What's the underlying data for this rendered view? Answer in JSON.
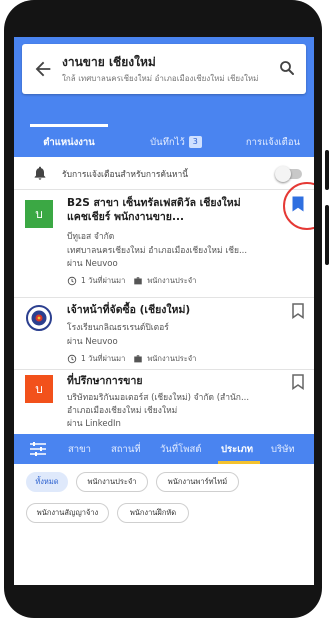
{
  "search": {
    "title": "งานขาย เชียงใหม่",
    "subtitle": "ใกล้ เทศบาลนครเชียงใหม่ อำเภอเมืองเชียงใหม่ เชียงใหม่"
  },
  "tabs": [
    {
      "label": "ตำแหน่งงาน",
      "active": true
    },
    {
      "label": "บันทึกไว้",
      "count": "3",
      "active": false
    },
    {
      "label": "การแจ้งเตือน",
      "active": false
    }
  ],
  "alert": {
    "text": "รับการแจ้งเตือนสำหรับการค้นหานี้",
    "enabled": false
  },
  "jobs": [
    {
      "logo_text": "บ",
      "logo_color": "#3ba844",
      "title_line1": "B2S สาขา เซ็นทรัลเฟสติวัล เชียงใหม่",
      "title_line2": "แคชเชียร์ พนักงานขาย...",
      "company": "บีทูเอส จำกัด",
      "location": "เทศบาลนครเชียงใหม่ อำเภอเมืองเชียงใหม่ เชีย...",
      "via": "ผ่าน Neuvoo",
      "posted": "1 วันที่ผ่านมา",
      "type": "พนักงานประจำ",
      "saved": true
    },
    {
      "logo_text": "",
      "logo_color": "#ffffff",
      "title_line1": "เจ้าหน้าที่จัดซื้อ (เชียงใหม่)",
      "company": "โรงเรียนกลิณธรเรนด์ปิเตอร์",
      "via": "ผ่าน Neuvoo",
      "posted": "1 วันที่ผ่านมา",
      "type": "พนักงานประจำ",
      "saved": false
    },
    {
      "logo_text": "บ",
      "logo_color": "#f2511b",
      "title_line1": "ที่ปรึกษาการขาย",
      "company": "บริษัทอมริกันมอเตอร์ส (เชียงใหม่) จำกัด (สำนัก...",
      "location": "อำเภอเมืองเชียงใหม่ เชียงใหม่",
      "via": "ผ่าน LinkedIn",
      "saved": false
    }
  ],
  "filter_bar": {
    "items": [
      {
        "label": "สาขา",
        "active": false
      },
      {
        "label": "สถานที่",
        "active": false
      },
      {
        "label": "วันที่โพสต์",
        "active": false
      },
      {
        "label": "ประเภท",
        "active": true
      },
      {
        "label": "บริษัท",
        "active": false
      }
    ]
  },
  "chips": [
    {
      "label": "ทั้งหมด",
      "selected": true
    },
    {
      "label": "พนักงานประจำ",
      "selected": false
    },
    {
      "label": "พนักงานพาร์ทไทม์",
      "selected": false
    },
    {
      "label": "พนักงานสัญญาจ้าง",
      "selected": false
    },
    {
      "label": "พนักงานฝึกหัด",
      "selected": false
    }
  ],
  "colors": {
    "primary": "#4a84f0",
    "bookmark_active": "#2f6fe0",
    "highlight": "#e53935",
    "accent_underline": "#f4c22e"
  }
}
